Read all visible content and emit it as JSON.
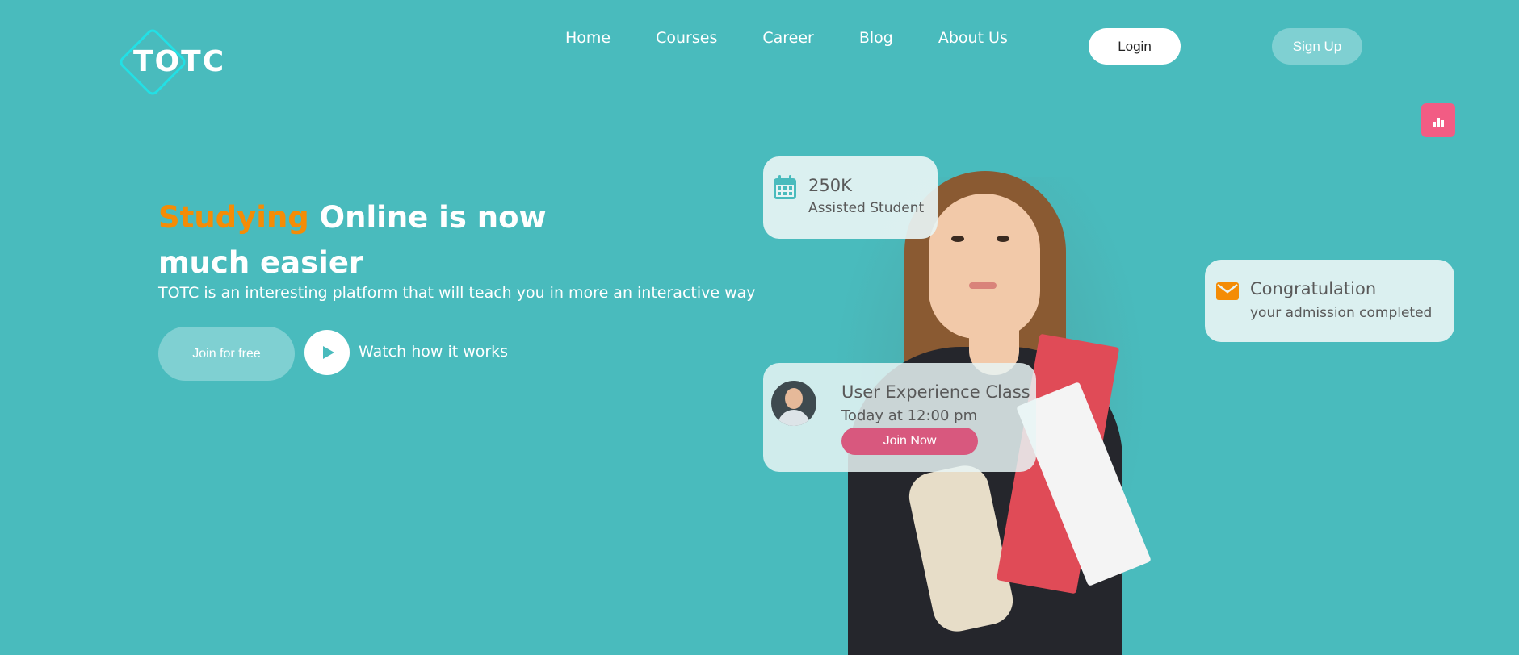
{
  "logo": {
    "text": "TOTC"
  },
  "nav": {
    "items": [
      {
        "label": "Home"
      },
      {
        "label": "Courses"
      },
      {
        "label": "Career"
      },
      {
        "label": "Blog"
      },
      {
        "label": "About Us"
      }
    ],
    "login_label": "Login",
    "signup_label": "Sign Up"
  },
  "hero": {
    "title_accent": "Studying",
    "title_rest": " Online is now much easier",
    "subtitle": "TOTC is an interesting platform that will teach you in more an interactive way",
    "join_label": "Join for free",
    "watch_label": "Watch how it works"
  },
  "cards": {
    "students": {
      "value": "250K",
      "label": "Assisted Student",
      "icon": "calendar-icon"
    },
    "congrats": {
      "title": "Congratulation",
      "subtitle": "your admission completed",
      "icon": "mail-icon"
    },
    "class": {
      "title": "User Experience Class",
      "time": "Today at 12:00 pm",
      "button_label": "Join Now"
    }
  },
  "colors": {
    "background": "#49BBBD",
    "accent": "#F48C06",
    "pink": "#D8587E",
    "chart_button": "#F25C84"
  }
}
